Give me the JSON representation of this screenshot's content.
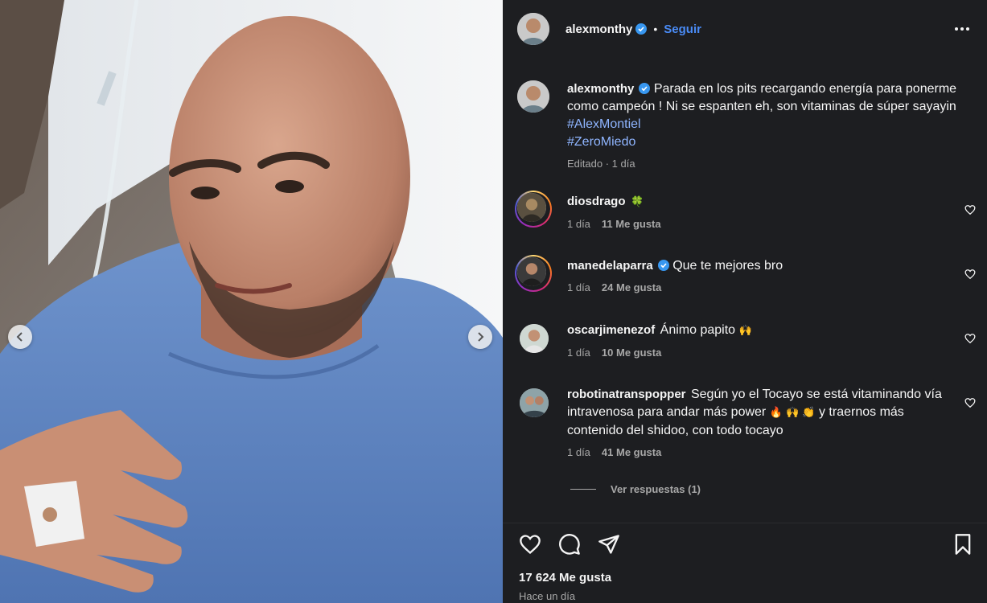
{
  "post": {
    "author": "alexmonthy",
    "follow_label": "Seguir",
    "separator": "•",
    "caption": {
      "text": "Parada en los pits recargando energía para ponerme como campeón ! Ni se espanten eh, son vitaminas de súper sayayin",
      "hashtags": [
        "#AlexMontiel",
        "#ZeroMiedo"
      ],
      "meta": "Editado · 1 día"
    },
    "likes_count": "17 624 Me gusta",
    "time_ago": "Hace un día"
  },
  "comments": [
    {
      "user": "diosdrago",
      "text": "",
      "emoji": "🍀",
      "time": "1 día",
      "likes": "11 Me gusta",
      "verified": false,
      "ring": true
    },
    {
      "user": "manedelaparra",
      "text": "Que te mejores bro",
      "emoji": "",
      "time": "1 día",
      "likes": "24 Me gusta",
      "verified": true,
      "ring": true
    },
    {
      "user": "oscarjimenezof",
      "text": "Ánimo papito",
      "emoji": "🙌",
      "time": "1 día",
      "likes": "10 Me gusta",
      "verified": false,
      "ring": false
    },
    {
      "user": "robotinatranspopper",
      "text_line1": "Según yo el Tocayo se está vitaminando",
      "text_line2": "vía intravenosa para andar más power",
      "emoji2": "🔥 🙌 👏",
      "text_line2b": "y traernos más",
      "text_line3": "contenido del shidoo, con todo tocayo",
      "time": "1 día",
      "likes": "41 Me gusta",
      "verified": false,
      "ring": false
    }
  ],
  "view_replies": "Ver respuestas (1)",
  "icons": {
    "more": "more-horizontal-icon",
    "like": "heart-icon",
    "comment": "comment-icon",
    "share": "paper-plane-icon",
    "save": "bookmark-icon",
    "verified": "verified-badge-icon",
    "prev": "chevron-left-icon",
    "next": "chevron-right-icon"
  },
  "colors": {
    "panel_bg": "#1d1e21",
    "link_blue": "#4a8cf7",
    "hashtag_blue": "#8fb5ff",
    "muted": "#a8a8a8"
  }
}
